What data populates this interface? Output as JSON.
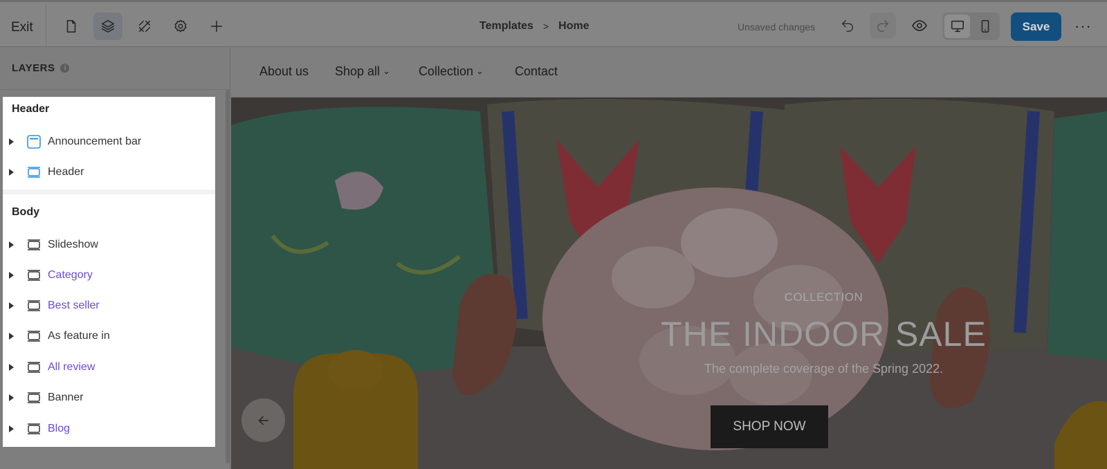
{
  "toolbar": {
    "exit_label": "Exit",
    "icons": [
      "page-icon",
      "layers-icon",
      "tools-icon",
      "gear-icon",
      "plus-icon"
    ],
    "breadcrumb": {
      "parent": "Templates",
      "separator": ">",
      "current": "Home"
    },
    "status": "Unsaved changes",
    "save_label": "Save",
    "more_label": "···",
    "save_color": "#124f7f"
  },
  "layers_panel": {
    "title": "LAYERS",
    "info_icon": "i",
    "sections": [
      {
        "title": "Header",
        "items": [
          {
            "label": "Announcement bar",
            "icon": "announcement-icon",
            "highlight": false
          },
          {
            "label": "Header",
            "icon": "section-icon",
            "highlight": false
          }
        ]
      },
      {
        "title": "Body",
        "items": [
          {
            "label": "Slideshow",
            "icon": "section-icon",
            "highlight": false
          },
          {
            "label": "Category",
            "icon": "section-icon",
            "highlight": true
          },
          {
            "label": "Best seller",
            "icon": "section-icon",
            "highlight": true
          },
          {
            "label": "As feature in",
            "icon": "section-icon",
            "highlight": false
          },
          {
            "label": "All review",
            "icon": "section-icon",
            "highlight": true
          },
          {
            "label": "Banner",
            "icon": "section-icon",
            "highlight": false
          },
          {
            "label": "Blog",
            "icon": "section-icon",
            "highlight": true
          }
        ]
      }
    ],
    "link_color": "#6a49d8"
  },
  "preview": {
    "nav": [
      {
        "label": "About us",
        "has_dropdown": false
      },
      {
        "label": "Shop all",
        "has_dropdown": true
      },
      {
        "label": "Collection",
        "has_dropdown": true
      },
      {
        "label": "Contact",
        "has_dropdown": false
      }
    ],
    "hero": {
      "eyebrow": "COLLECTION",
      "headline": "THE INDOOR SALE",
      "subtitle": "The complete coverage of the Spring 2022.",
      "cta": "SHOP NOW"
    }
  }
}
